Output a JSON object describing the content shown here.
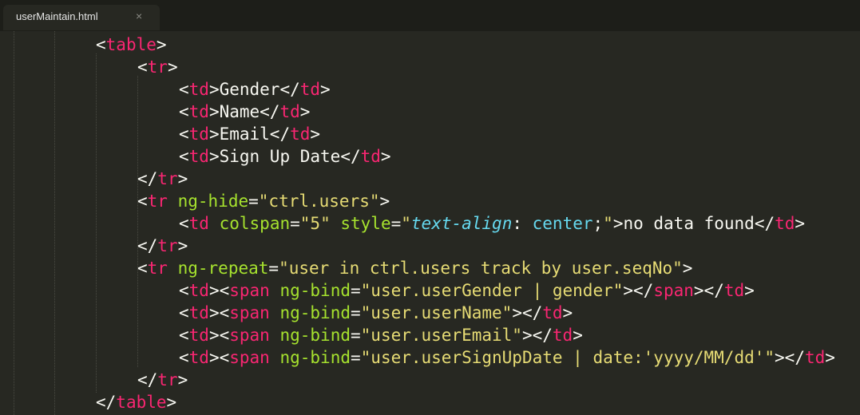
{
  "tab": {
    "title": "userMaintain.html",
    "close_glyph": "×"
  },
  "colors": {
    "background": "#272822",
    "tag": "#f92672",
    "attribute": "#a6e22e",
    "string": "#e6db74",
    "css": "#66d9ef",
    "text": "#f8f8f2"
  },
  "code_lines": [
    {
      "indent": 2,
      "tokens": [
        [
          "p",
          "<"
        ],
        [
          "t",
          "table"
        ],
        [
          "p",
          ">"
        ]
      ]
    },
    {
      "indent": 3,
      "tokens": [
        [
          "p",
          "<"
        ],
        [
          "t",
          "tr"
        ],
        [
          "p",
          ">"
        ]
      ]
    },
    {
      "indent": 4,
      "tokens": [
        [
          "p",
          "<"
        ],
        [
          "t",
          "td"
        ],
        [
          "p",
          ">Gender</"
        ],
        [
          "t",
          "td"
        ],
        [
          "p",
          ">"
        ]
      ]
    },
    {
      "indent": 4,
      "tokens": [
        [
          "p",
          "<"
        ],
        [
          "t",
          "td"
        ],
        [
          "p",
          ">Name</"
        ],
        [
          "t",
          "td"
        ],
        [
          "p",
          ">"
        ]
      ]
    },
    {
      "indent": 4,
      "tokens": [
        [
          "p",
          "<"
        ],
        [
          "t",
          "td"
        ],
        [
          "p",
          ">Email</"
        ],
        [
          "t",
          "td"
        ],
        [
          "p",
          ">"
        ]
      ]
    },
    {
      "indent": 4,
      "tokens": [
        [
          "p",
          "<"
        ],
        [
          "t",
          "td"
        ],
        [
          "p",
          ">Sign Up Date</"
        ],
        [
          "t",
          "td"
        ],
        [
          "p",
          ">"
        ]
      ]
    },
    {
      "indent": 3,
      "tokens": [
        [
          "p",
          "</"
        ],
        [
          "t",
          "tr"
        ],
        [
          "p",
          ">"
        ]
      ]
    },
    {
      "indent": 3,
      "tokens": [
        [
          "p",
          "<"
        ],
        [
          "t",
          "tr"
        ],
        [
          "p",
          " "
        ],
        [
          "a",
          "ng-hide"
        ],
        [
          "p",
          "="
        ],
        [
          "s",
          "\"ctrl.users\""
        ],
        [
          "p",
          ">"
        ]
      ]
    },
    {
      "indent": 4,
      "tokens": [
        [
          "p",
          "<"
        ],
        [
          "t",
          "td"
        ],
        [
          "p",
          " "
        ],
        [
          "a",
          "colspan"
        ],
        [
          "p",
          "="
        ],
        [
          "s",
          "\"5\""
        ],
        [
          "p",
          " "
        ],
        [
          "a",
          "style"
        ],
        [
          "p",
          "="
        ],
        [
          "s",
          "\""
        ],
        [
          "cp",
          "text-align"
        ],
        [
          "p",
          ": "
        ],
        [
          "cv",
          "center"
        ],
        [
          "p",
          ";"
        ],
        [
          "s",
          "\""
        ],
        [
          "p",
          ">no data found</"
        ],
        [
          "t",
          "td"
        ],
        [
          "p",
          ">"
        ]
      ]
    },
    {
      "indent": 3,
      "tokens": [
        [
          "p",
          "</"
        ],
        [
          "t",
          "tr"
        ],
        [
          "p",
          ">"
        ]
      ]
    },
    {
      "indent": 3,
      "tokens": [
        [
          "p",
          "<"
        ],
        [
          "t",
          "tr"
        ],
        [
          "p",
          " "
        ],
        [
          "a",
          "ng-repeat"
        ],
        [
          "p",
          "="
        ],
        [
          "s",
          "\"user in ctrl.users track by user.seqNo\""
        ],
        [
          "p",
          ">"
        ]
      ]
    },
    {
      "indent": 4,
      "tokens": [
        [
          "p",
          "<"
        ],
        [
          "t",
          "td"
        ],
        [
          "p",
          "><"
        ],
        [
          "t",
          "span"
        ],
        [
          "p",
          " "
        ],
        [
          "a",
          "ng-bind"
        ],
        [
          "p",
          "="
        ],
        [
          "s",
          "\"user.userGender | gender\""
        ],
        [
          "p",
          "></"
        ],
        [
          "t",
          "span"
        ],
        [
          "p",
          "></"
        ],
        [
          "t",
          "td"
        ],
        [
          "p",
          ">"
        ]
      ]
    },
    {
      "indent": 4,
      "tokens": [
        [
          "p",
          "<"
        ],
        [
          "t",
          "td"
        ],
        [
          "p",
          "><"
        ],
        [
          "t",
          "span"
        ],
        [
          "p",
          " "
        ],
        [
          "a",
          "ng-bind"
        ],
        [
          "p",
          "="
        ],
        [
          "s",
          "\"user.userName\""
        ],
        [
          "p",
          "></"
        ],
        [
          "t",
          "td"
        ],
        [
          "p",
          ">"
        ]
      ]
    },
    {
      "indent": 4,
      "tokens": [
        [
          "p",
          "<"
        ],
        [
          "t",
          "td"
        ],
        [
          "p",
          "><"
        ],
        [
          "t",
          "span"
        ],
        [
          "p",
          " "
        ],
        [
          "a",
          "ng-bind"
        ],
        [
          "p",
          "="
        ],
        [
          "s",
          "\"user.userEmail\""
        ],
        [
          "p",
          "></"
        ],
        [
          "t",
          "td"
        ],
        [
          "p",
          ">"
        ]
      ]
    },
    {
      "indent": 4,
      "tokens": [
        [
          "p",
          "<"
        ],
        [
          "t",
          "td"
        ],
        [
          "p",
          "><"
        ],
        [
          "t",
          "span"
        ],
        [
          "p",
          " "
        ],
        [
          "a",
          "ng-bind"
        ],
        [
          "p",
          "="
        ],
        [
          "s",
          "\"user.userSignUpDate | date:'yyyy/MM/dd'\""
        ],
        [
          "p",
          "></"
        ],
        [
          "t",
          "td"
        ],
        [
          "p",
          ">"
        ]
      ]
    },
    {
      "indent": 3,
      "tokens": [
        [
          "p",
          "</"
        ],
        [
          "t",
          "tr"
        ],
        [
          "p",
          ">"
        ]
      ]
    },
    {
      "indent": 2,
      "tokens": [
        [
          "p",
          "</"
        ],
        [
          "t",
          "table"
        ],
        [
          "p",
          ">"
        ]
      ]
    }
  ]
}
